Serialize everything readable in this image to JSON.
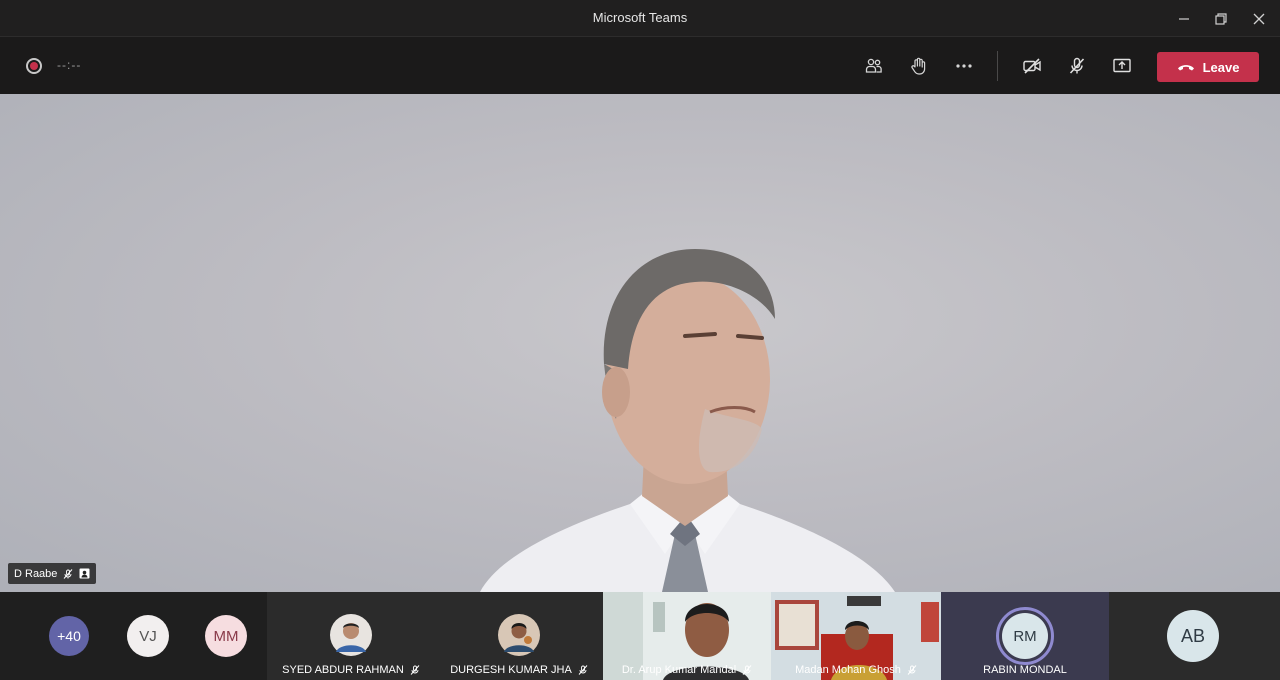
{
  "window": {
    "title": "Microsoft Teams"
  },
  "toolbar": {
    "timer": "--:--",
    "leave_label": "Leave",
    "buttons": [
      "participants-icon",
      "raise-hand-icon",
      "more-icon",
      "camera-off-icon",
      "mic-off-icon",
      "share-screen-icon"
    ]
  },
  "main": {
    "speaker_name": "D Raabe"
  },
  "strip": {
    "overflow_count": "+40",
    "initials": [
      {
        "text": "VJ"
      },
      {
        "text": "MM"
      }
    ],
    "tiles": [
      {
        "name": "SYED ABDUR RAHMAN"
      },
      {
        "name": "DURGESH KUMAR JHA"
      },
      {
        "name": "Dr. Arup Kumar Mandal"
      },
      {
        "name": "Madan Mohan Ghosh"
      },
      {
        "name": "RABIN MONDAL",
        "initials": "RM"
      },
      {
        "initials": "AB"
      }
    ]
  },
  "colors": {
    "leave": "#c4314b",
    "overflow_badge": "#6264a7",
    "mm_avatar": "#f6dde0"
  }
}
